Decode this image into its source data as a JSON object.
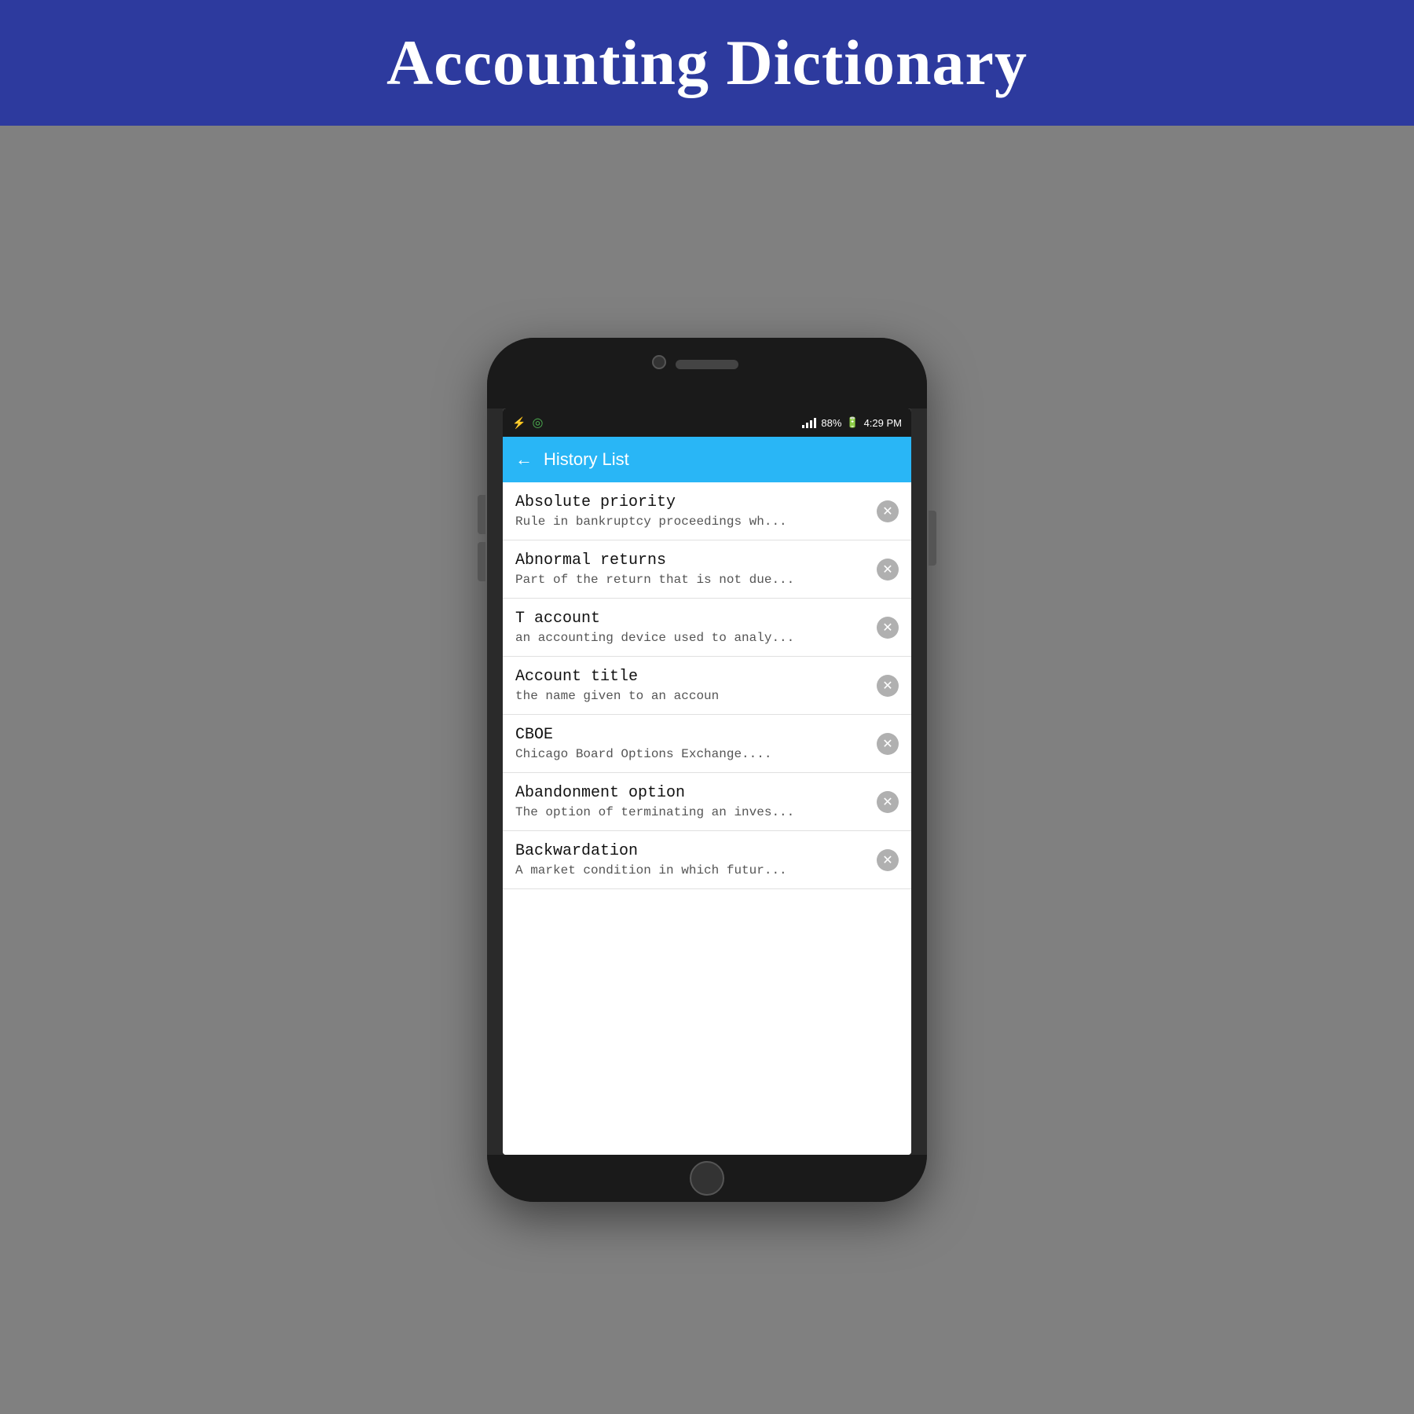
{
  "banner": {
    "title": "Accounting Dictionary"
  },
  "status_bar": {
    "usb_icon": "⚡",
    "location_icon": "◎",
    "signal": "88%",
    "battery_icon": "🔋",
    "time": "4:29 PM"
  },
  "app_bar": {
    "back_label": "←",
    "title": "History List"
  },
  "list_items": [
    {
      "title": "Absolute priority",
      "description": "Rule in bankruptcy proceedings wh..."
    },
    {
      "title": "Abnormal returns",
      "description": "Part of the return that is not due..."
    },
    {
      "title": "T account",
      "description": "an accounting device used to analy..."
    },
    {
      "title": "Account title",
      "description": "the name given to an accoun"
    },
    {
      "title": "CBOE",
      "description": "Chicago Board Options Exchange...."
    },
    {
      "title": "Abandonment option",
      "description": "The option of terminating an inves..."
    },
    {
      "title": "Backwardation",
      "description": "A market condition in which futur..."
    }
  ],
  "close_button_label": "✕",
  "colors": {
    "banner_bg": "#2d3a9e",
    "app_bar_bg": "#29b6f6",
    "background": "#808080"
  }
}
